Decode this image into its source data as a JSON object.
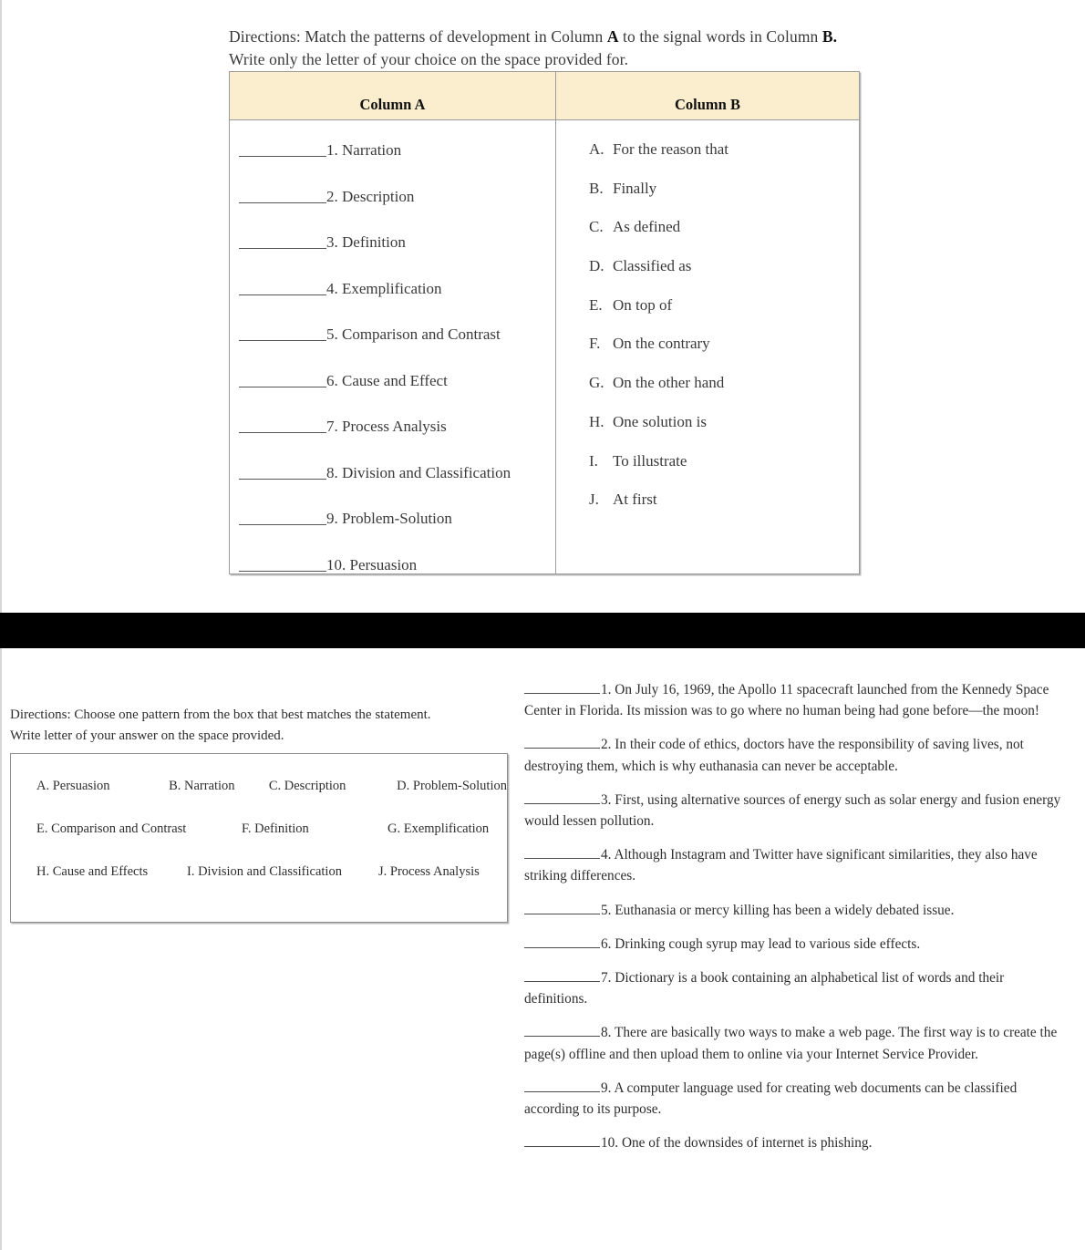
{
  "page_top": {
    "directions_prefix": "Directions: Match the patterns of development in Column ",
    "directions_bold_a": "A",
    "directions_mid": " to the signal words in Column ",
    "directions_bold_b": "B.",
    "directions_suffix": " Write only the letter of your choice on the space provided for.",
    "directions_full": "Directions: Match the patterns of development in Column A to the signal words in Column B. Write only the letter of your choice on the space provided for.",
    "table": {
      "header_a": "Column A",
      "header_b": "Column B",
      "header_bg": "#fbeece",
      "border_color": "#9b9b9b",
      "column_a": [
        {
          "number": "1.",
          "label": "Narration"
        },
        {
          "number": "2.",
          "label": "Description"
        },
        {
          "number": "3.",
          "label": "Definition"
        },
        {
          "number": "4.",
          "label": "Exemplification"
        },
        {
          "number": "5.",
          "label": "Comparison and Contrast"
        },
        {
          "number": "6.",
          "label": "Cause and Effect"
        },
        {
          "number": "7.",
          "label": "Process Analysis"
        },
        {
          "number": "8.",
          "label": "Division and Classification"
        },
        {
          "number": "9.",
          "label": "Problem-Solution"
        },
        {
          "number": "10.",
          "label": "Persuasion"
        }
      ],
      "column_b": [
        {
          "letter": "A.",
          "text": "For the reason that"
        },
        {
          "letter": "B.",
          "text": "Finally"
        },
        {
          "letter": "C.",
          "text": "As defined"
        },
        {
          "letter": "D.",
          "text": "Classified as"
        },
        {
          "letter": "E.",
          "text": "On top of"
        },
        {
          "letter": "F.",
          "text": "On the contrary"
        },
        {
          "letter": "G.",
          "text": "On the other hand"
        },
        {
          "letter": "H.",
          "text": "One solution is"
        },
        {
          "letter": "I.",
          "text": "To illustrate"
        },
        {
          "letter": "J.",
          "text": "At first"
        }
      ]
    }
  },
  "separator": {
    "color": "#000000"
  },
  "page_bottom": {
    "directions_line1": "Directions: Choose one pattern from the box that best matches the statement.",
    "directions_line2": "Write letter of your answer on the space provided.",
    "choice_box": {
      "row1": [
        "A.  Persuasion",
        "B. Narration",
        "C.  Description",
        "D.  Problem-Solution"
      ],
      "row2": [
        "E. Comparison and Contrast",
        "F. Definition",
        "G.  Exemplification"
      ],
      "row3": [
        "H. Cause and Effects",
        "I.  Division and Classification",
        "J. Process Analysis"
      ]
    },
    "statements": [
      {
        "number": "1.",
        "text": " On July 16, 1969, the Apollo 11 spacecraft launched from the Kennedy Space Center in Florida. Its mission was to go where no human being had gone before—the moon!"
      },
      {
        "number": "2.",
        "text": " In their code of ethics, doctors have the responsibility of saving lives, not destroying them, which is why euthanasia can never be acceptable."
      },
      {
        "number": "3.",
        "text": " First, using alternative sources of energy such as solar energy and fusion energy would lessen pollution."
      },
      {
        "number": "4.",
        "text": " Although Instagram and Twitter have significant similarities, they also have striking differences."
      },
      {
        "number": "5.",
        "text": " Euthanasia or mercy killing has been a widely debated issue."
      },
      {
        "number": "6.",
        "text": " Drinking cough syrup may lead to various side effects."
      },
      {
        "number": "7.",
        "text": " Dictionary is a book containing an alphabetical list of words and their definitions."
      },
      {
        "number": "8.",
        "text": " There are basically two ways to make a web page. The first way is to create the page(s) offline and then upload them to online via your Internet Service Provider."
      },
      {
        "number": "9.",
        "text": " A computer language used for creating web documents can be classified according to its purpose."
      },
      {
        "number": "10.",
        "text": " One of the downsides of internet is phishing."
      }
    ]
  }
}
